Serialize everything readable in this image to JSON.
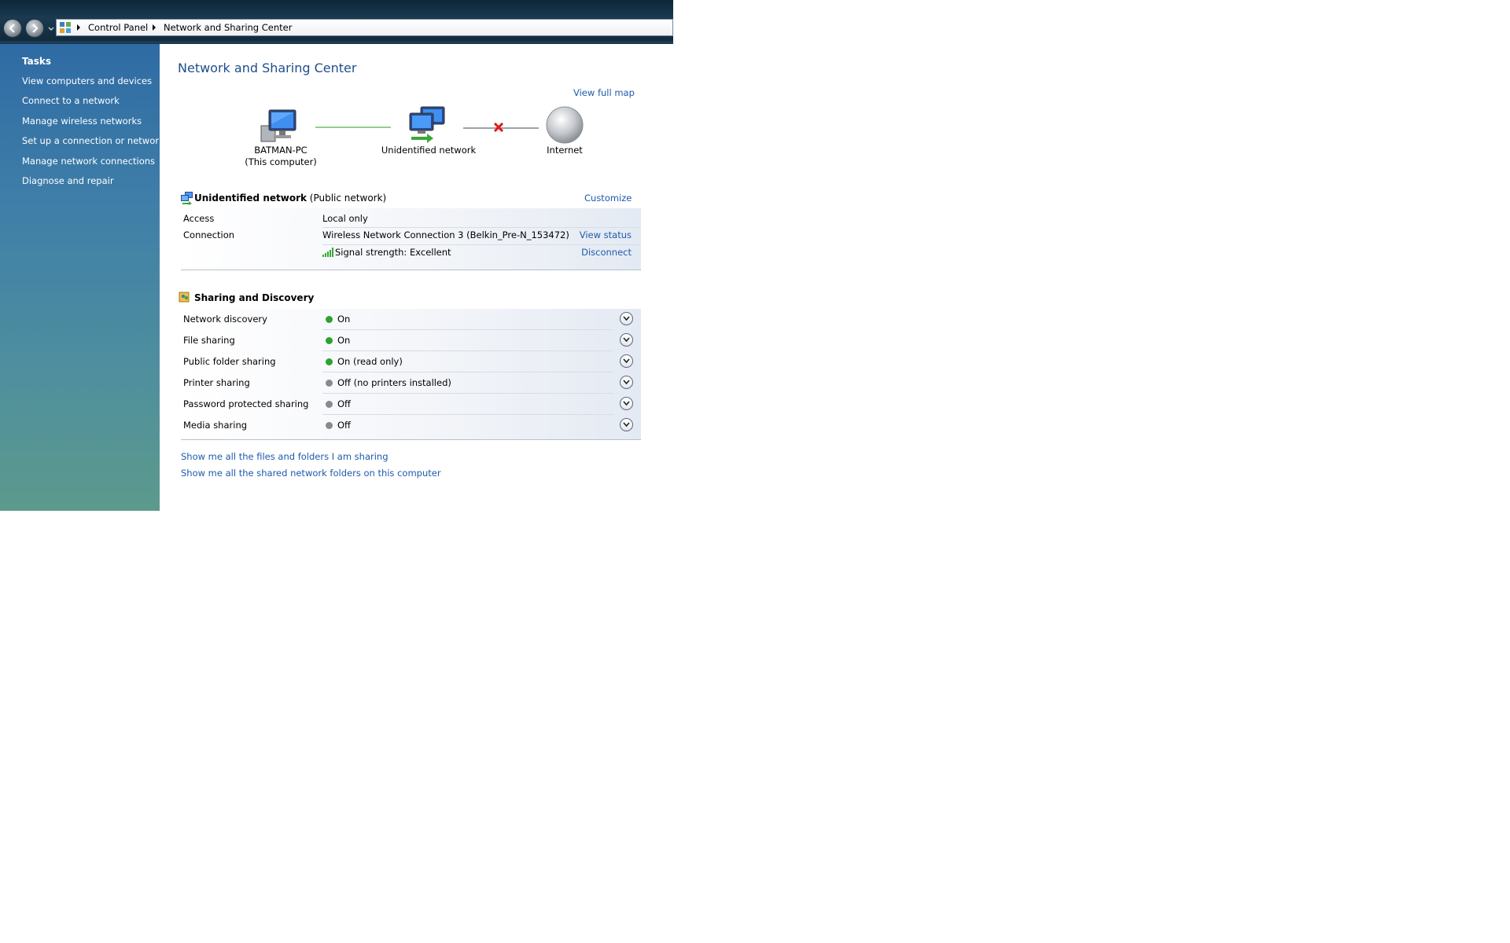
{
  "address_bar": {
    "crumbs": [
      "Control Panel",
      "Network and Sharing Center"
    ]
  },
  "sidebar": {
    "title": "Tasks",
    "links": [
      "View computers and devices",
      "Connect to a network",
      "Manage wireless networks",
      "Set up a connection or network",
      "Manage network connections",
      "Diagnose and repair"
    ]
  },
  "main": {
    "title": "Network and Sharing Center",
    "view_full_map": "View full map",
    "map": {
      "computer_name": "BATMAN-PC",
      "computer_sub": "(This computer)",
      "network_name": "Unidentified network",
      "internet": "Internet"
    },
    "network": {
      "name": "Unidentified network",
      "type": "(Public network)",
      "customize": "Customize",
      "access_label": "Access",
      "access_value": "Local only",
      "connection_label": "Connection",
      "connection_value": "Wireless Network Connection 3 (Belkin_Pre-N_153472)",
      "view_status": "View status",
      "signal_label": "Signal strength:",
      "signal_value": "Excellent",
      "disconnect": "Disconnect"
    },
    "sharing": {
      "title": "Sharing and Discovery",
      "rows": [
        {
          "label": "Network discovery",
          "value": "On",
          "status": "on"
        },
        {
          "label": "File sharing",
          "value": "On",
          "status": "on"
        },
        {
          "label": "Public folder sharing",
          "value": "On (read only)",
          "status": "on"
        },
        {
          "label": "Printer sharing",
          "value": "Off (no printers installed)",
          "status": "off"
        },
        {
          "label": "Password protected sharing",
          "value": "Off",
          "status": "off"
        },
        {
          "label": "Media sharing",
          "value": "Off",
          "status": "off"
        }
      ]
    },
    "bottom_links": [
      "Show me all the files and folders I am sharing",
      "Show me all the shared network folders on this computer"
    ]
  },
  "colors": {
    "status_on": "#2fa12f",
    "status_off": "#8a8a8a",
    "link": "#1e5aab",
    "title": "#1e4d8c"
  }
}
